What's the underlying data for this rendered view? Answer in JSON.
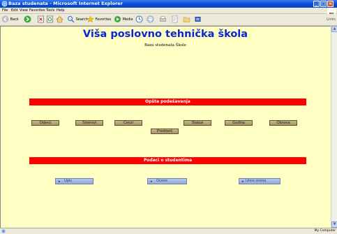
{
  "window": {
    "title": "Baza studenata - Microsoft Internet Explorer",
    "minimize_glyph": "_",
    "maximize_glyph": "□",
    "close_glyph": "×"
  },
  "menubar": {
    "items": [
      "File",
      "Edit",
      "View",
      "Favorites",
      "Tools",
      "Help"
    ]
  },
  "toolbar": {
    "back_label": "Back",
    "search_label": "Search",
    "favorites_label": "Favorites",
    "media_label": "Media",
    "links_label": "Links"
  },
  "page": {
    "heading": "Viša poslovno tehnička škola",
    "subheading": "Baza studenata Škole",
    "section1_title": "Opšta podešavanja",
    "section2_title": "Podaci o studentima",
    "buttons_row1": [
      "Odseci",
      "Smerovi",
      "Cenzi",
      "Statusi",
      "Godina",
      "Obnova"
    ],
    "button_row2": "Predmeti",
    "link_buttons": [
      "Upis",
      "Ocene",
      "Unos ocena"
    ]
  },
  "statusbar": {
    "zone": "My Computer"
  },
  "colors": {
    "page_background": "#ffffc4",
    "heading": "#0b26d6",
    "section_bar": "#ff0000",
    "button": "#b8a679",
    "link_button": "#a7bbe3"
  }
}
